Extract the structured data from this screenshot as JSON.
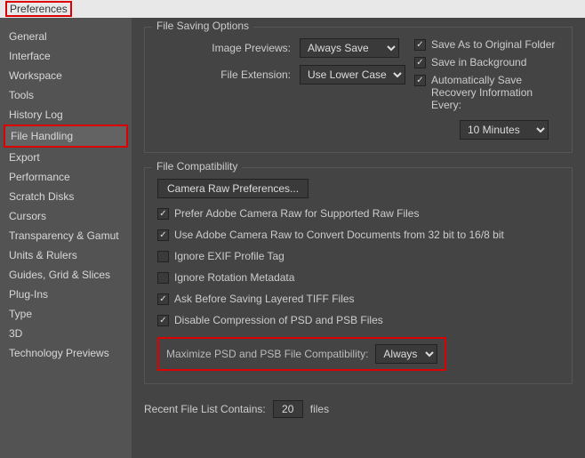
{
  "window": {
    "title": "Preferences"
  },
  "sidebar": {
    "items": [
      {
        "label": "General"
      },
      {
        "label": "Interface"
      },
      {
        "label": "Workspace"
      },
      {
        "label": "Tools"
      },
      {
        "label": "History Log"
      },
      {
        "label": "File Handling"
      },
      {
        "label": "Export"
      },
      {
        "label": "Performance"
      },
      {
        "label": "Scratch Disks"
      },
      {
        "label": "Cursors"
      },
      {
        "label": "Transparency & Gamut"
      },
      {
        "label": "Units & Rulers"
      },
      {
        "label": "Guides, Grid & Slices"
      },
      {
        "label": "Plug-Ins"
      },
      {
        "label": "Type"
      },
      {
        "label": "3D"
      },
      {
        "label": "Technology Previews"
      }
    ]
  },
  "file_saving": {
    "title": "File Saving Options",
    "image_previews_label": "Image Previews:",
    "image_previews_value": "Always Save",
    "file_extension_label": "File Extension:",
    "file_extension_value": "Use Lower Case",
    "chk_save_original": "Save As to Original Folder",
    "chk_save_background": "Save in Background",
    "chk_auto_recovery": "Automatically Save Recovery Information Every:",
    "recovery_interval": "10 Minutes"
  },
  "file_compat": {
    "title": "File Compatibility",
    "camera_raw_btn": "Camera Raw Preferences...",
    "chk_prefer_acr": "Prefer Adobe Camera Raw for Supported Raw Files",
    "chk_use_acr_convert": "Use Adobe Camera Raw to Convert Documents from 32 bit to 16/8 bit",
    "chk_ignore_exif": "Ignore EXIF Profile Tag",
    "chk_ignore_rotation": "Ignore Rotation Metadata",
    "chk_ask_tiff": "Ask Before Saving Layered TIFF Files",
    "chk_disable_compression": "Disable Compression of PSD and PSB Files",
    "max_compat_label": "Maximize PSD and PSB File Compatibility:",
    "max_compat_value": "Always"
  },
  "recent": {
    "label": "Recent File List Contains:",
    "value": "20",
    "suffix": "files"
  }
}
